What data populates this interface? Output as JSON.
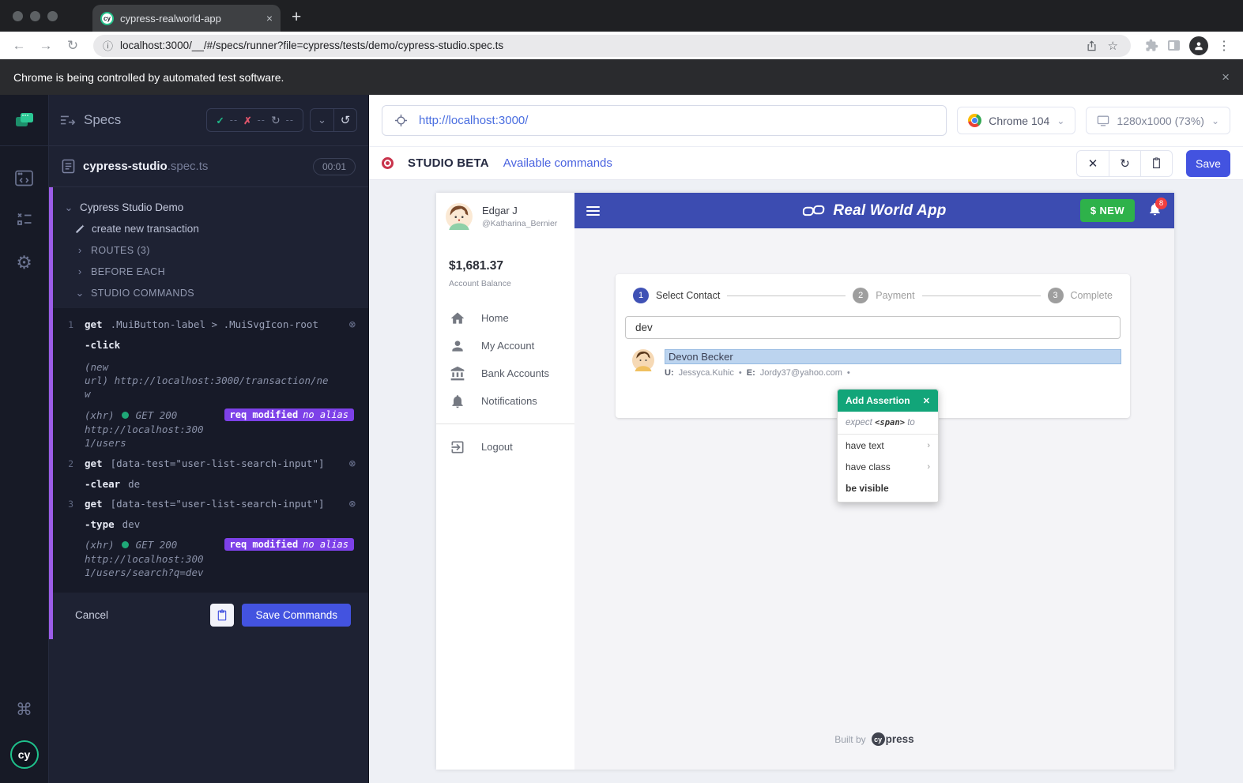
{
  "colors": {
    "appbar_indigo": "#3c4cb1",
    "save_indigo": "#4353e0",
    "studio_green": "#12a579",
    "badge_purple": "#7d41e8",
    "new_button_green": "#2eb24a",
    "notification_red": "#f23f3f",
    "pass_green": "#1fb787",
    "fail_red": "#e0556b",
    "studio_accent_purple": "#9c5de8",
    "highlight_blue": "#bcd4ef"
  },
  "icons": {
    "close": "×",
    "plus": "+",
    "back": "←",
    "forward": "→",
    "reload": "↻",
    "info": "ⓘ",
    "star": "☆",
    "dots": "⋮",
    "gear": "⚙",
    "command": "⌘",
    "chevron_down": "⌄",
    "chevron_right": "›",
    "restart": "↺",
    "delete_cmd": "⊗",
    "x_btn": "✕",
    "bullet": "•"
  },
  "browser": {
    "tab_title": "cypress-realworld-app",
    "favicon_text": "cy",
    "url": "localhost:3000/__/#/specs/runner?file=cypress/tests/demo/cypress-studio.spec.ts",
    "banner_text": "Chrome is being controlled by automated test software."
  },
  "specs": {
    "title": "Specs",
    "stats": {
      "passed": "--",
      "failed": "--",
      "pending": "--"
    },
    "spec_name": "cypress-studio",
    "spec_ext": ".spec.ts",
    "duration": "00:01",
    "suite": "Cypress Studio Demo",
    "test_name": "create new transaction",
    "routes_label": "ROUTES (3)",
    "before_each_label": "BEFORE EACH",
    "studio_label": "STUDIO COMMANDS",
    "commands": [
      {
        "num": "1",
        "name": "get",
        "arg": ".MuiButton-label > .MuiSvgIcon-root",
        "action": "-click",
        "new_url": "(new\nurl)  http://localhost:3000/transaction/ne\nw",
        "xhr_label": "(xhr)",
        "xhr_status": "GET 200",
        "badge": "req modified",
        "badge_alias": "no alias",
        "xhr_url": "http://localhost:300\n1/users"
      },
      {
        "num": "2",
        "name": "get",
        "arg": "[data-test=\"user-list-search-input\"]",
        "action": "-clear",
        "action_arg": "de"
      },
      {
        "num": "3",
        "name": "get",
        "arg": "[data-test=\"user-list-search-input\"]",
        "action": "-type",
        "action_arg": "dev",
        "xhr_label": "(xhr)",
        "xhr_status": "GET 200",
        "badge": "req modified",
        "badge_alias": "no alias",
        "xhr_url": "http://localhost:300\n1/users/search?q=dev"
      }
    ],
    "cancel_label": "Cancel",
    "save_label": "Save Commands"
  },
  "runner": {
    "url_value": "http://localhost:3000/",
    "browser_name": "Chrome 104",
    "viewport": "1280x1000 (73%)",
    "studio_badge": "STUDIO BETA",
    "available_commands": "Available commands",
    "save_label": "Save"
  },
  "app": {
    "user_name": "Edgar J",
    "user_handle": "@Katharina_Bernier",
    "balance": "$1,681.37",
    "balance_label": "Account Balance",
    "nav": [
      "Home",
      "My Account",
      "Bank Accounts",
      "Notifications"
    ],
    "logout_label": "Logout",
    "app_title": "Real World App",
    "new_button": "$ NEW",
    "notification_count": "8",
    "steps": [
      {
        "num": "1",
        "label": "Select Contact"
      },
      {
        "num": "2",
        "label": "Payment"
      },
      {
        "num": "3",
        "label": "Complete"
      }
    ],
    "search_value": "dev",
    "contact": {
      "name": "Devon Becker",
      "u_label": "U:",
      "username": "Jessyca.Kuhic",
      "e_label": "E:",
      "email": "Jordy37@yahoo.com",
      "sep": "•"
    },
    "assertion": {
      "title": "Add Assertion",
      "expect_pre": "expect",
      "expect_tag": "<span>",
      "expect_post": "to",
      "options": [
        "have text",
        "have class",
        "be visible"
      ]
    },
    "footer": {
      "pre": "Built by",
      "logo_cy": "cy",
      "logo_rest": "press"
    }
  }
}
